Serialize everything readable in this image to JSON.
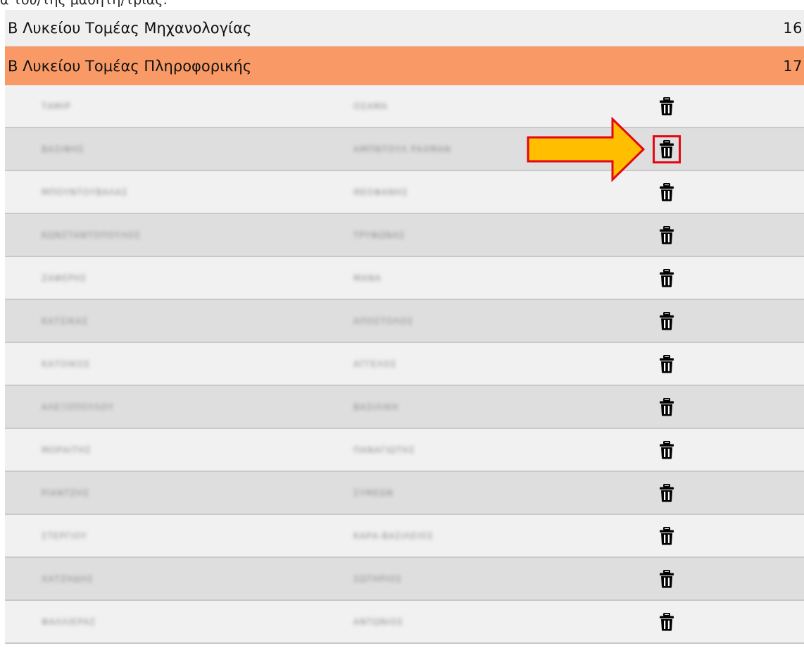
{
  "top_fragment": "α του/της μαθητή/τριας:",
  "groups": [
    {
      "label": "Β Λυκείου Τομέας Μηχανολογίας",
      "count": "16"
    },
    {
      "label": "Β Λυκείου Τομέας Πληροφορικής",
      "count": "17"
    }
  ],
  "colors": {
    "active_group": "#f99a66",
    "row_light": "#f1f1f1",
    "row_dark": "#dedede",
    "arrow_fill": "#ffbf00",
    "arrow_stroke": "#e30613"
  },
  "students": [
    {
      "surname": "ΤΑΜΙΡ",
      "firstname": "ΟΣΑΜΑ"
    },
    {
      "surname": "ΒΑΣΙΦΗΣ",
      "firstname": "ΑΜΠΝΤΟΥΛ ΡΑΧΜΑΝ"
    },
    {
      "surname": "ΜΠΟΥΝΤΟΥΒΑΛΑΣ",
      "firstname": "ΘΕΟΦΑΝΗΣ"
    },
    {
      "surname": "ΚΩΝΣΤΑΝΤΟΠΟΥΛΟΣ",
      "firstname": "ΤΡΥΦΩΝΑΣ"
    },
    {
      "surname": "ΖΑΦΕΡΗΣ",
      "firstname": "ΜΑΝΑ"
    },
    {
      "surname": "ΚΑΤΣΙΚΑΣ",
      "firstname": "ΑΠΟΣΤΟΛΟΣ"
    },
    {
      "surname": "ΚΑΤΟΙΚΟΣ",
      "firstname": "ΑΓΓΕΛΟΣ"
    },
    {
      "surname": "ΑΛΕΞΟΠΟΥΛΟΥ",
      "firstname": "ΒΑΣΙΛΙΚΗ"
    },
    {
      "surname": "ΜΟΡΑΙΤΗΣ",
      "firstname": "ΠΑΝΑΓΙΩΤΗΣ"
    },
    {
      "surname": "ΡΙΑΝΤΖΗΣ",
      "firstname": "ΣΥΜΕΩΝ"
    },
    {
      "surname": "ΣΤΕΡΓΙΟΥ",
      "firstname": "ΚΑΡΑ-ΒΑΣΙΛΕΙΟΣ"
    },
    {
      "surname": "ΧΑΤΖΗΔΗΣ",
      "firstname": "ΣΩΤΗΡΙΟΣ"
    },
    {
      "surname": "ΦΑΛΛΙΕΡΑΣ",
      "firstname": "ΑΝΤΩΝΙΟΣ"
    }
  ],
  "icons": {
    "delete": "trash-icon",
    "pointer": "arrow-right-icon"
  },
  "highlighted_row": 1
}
